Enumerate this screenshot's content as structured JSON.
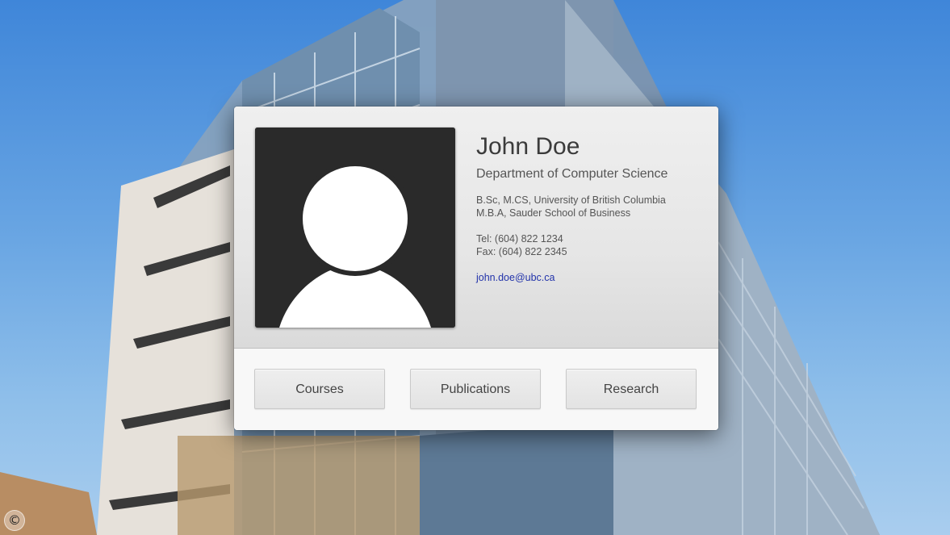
{
  "profile": {
    "name": "John Doe",
    "department": "Department of Computer Science",
    "degrees": [
      "B.Sc, M.CS, University of British Columbia",
      "M.B.A, Sauder School of Business"
    ],
    "tel": "Tel: (604) 822 1234",
    "fax": "Fax: (604) 822 2345",
    "email": "john.doe@ubc.ca",
    "avatar_icon": "user-silhouette-icon"
  },
  "nav": {
    "buttons": [
      {
        "label": "Courses"
      },
      {
        "label": "Publications"
      },
      {
        "label": "Research"
      }
    ]
  },
  "footer": {
    "copyright_symbol": "©"
  },
  "colors": {
    "link": "#2233aa",
    "avatar_bg": "#2a2a2a",
    "sky": "#3f86d9"
  }
}
